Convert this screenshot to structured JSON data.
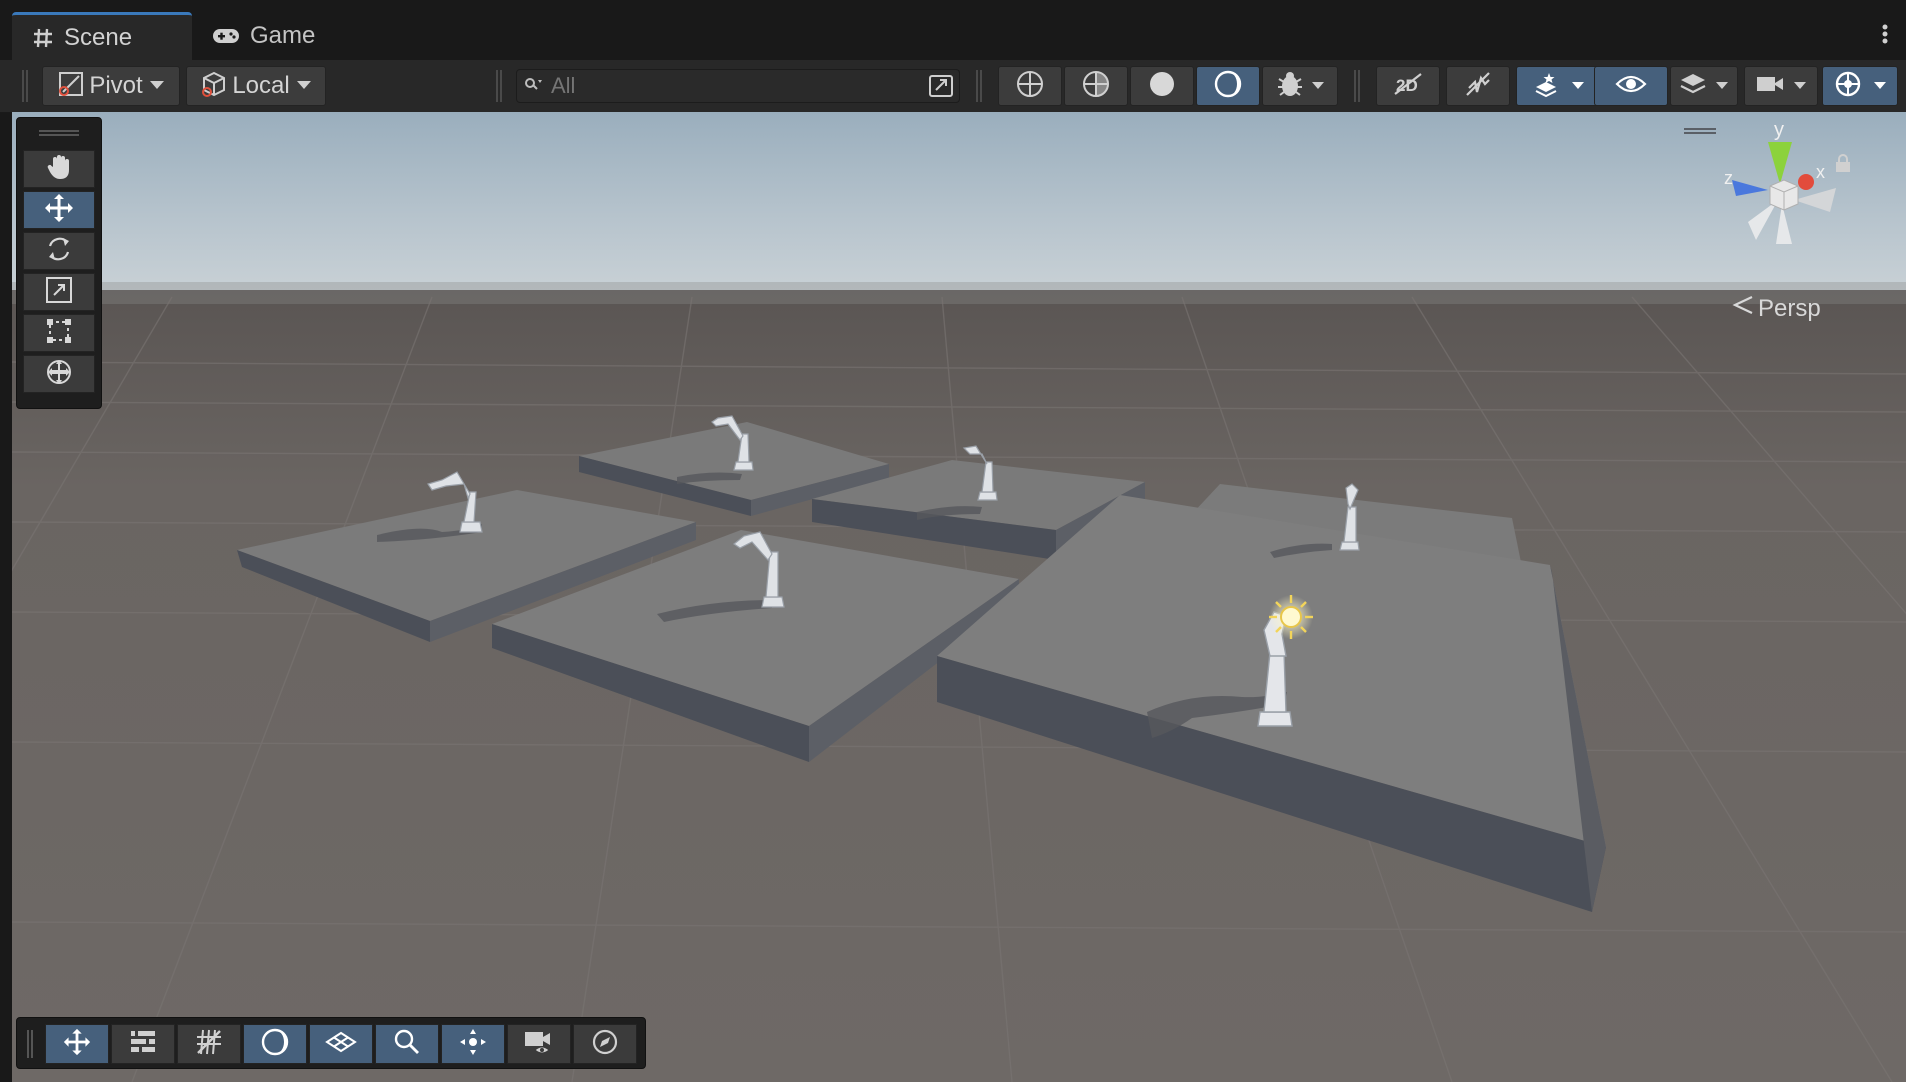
{
  "tabs": [
    {
      "label": "Scene",
      "icon": "grid-hash-icon",
      "active": true
    },
    {
      "label": "Game",
      "icon": "gamepad-icon",
      "active": false
    }
  ],
  "toolbar": {
    "pivot_label": "Pivot",
    "local_label": "Local",
    "search": {
      "placeholder": "All",
      "value": ""
    }
  },
  "scene_view": {
    "projection_label": "Persp",
    "gizmo_axes": {
      "x": "x",
      "y": "y",
      "z": "z"
    },
    "tool_palette": [
      "hand-tool-icon",
      "move-tool-icon",
      "rotate-tool-icon",
      "scale-tool-icon",
      "rect-tool-icon",
      "transform-tool-icon"
    ],
    "active_tool": "move-tool-icon"
  },
  "colors": {
    "accent": "#46607c",
    "tab_highlight": "#3a79bb",
    "panel": "#282828",
    "ground": "#686360",
    "platform_top": "#7c7c7c"
  }
}
